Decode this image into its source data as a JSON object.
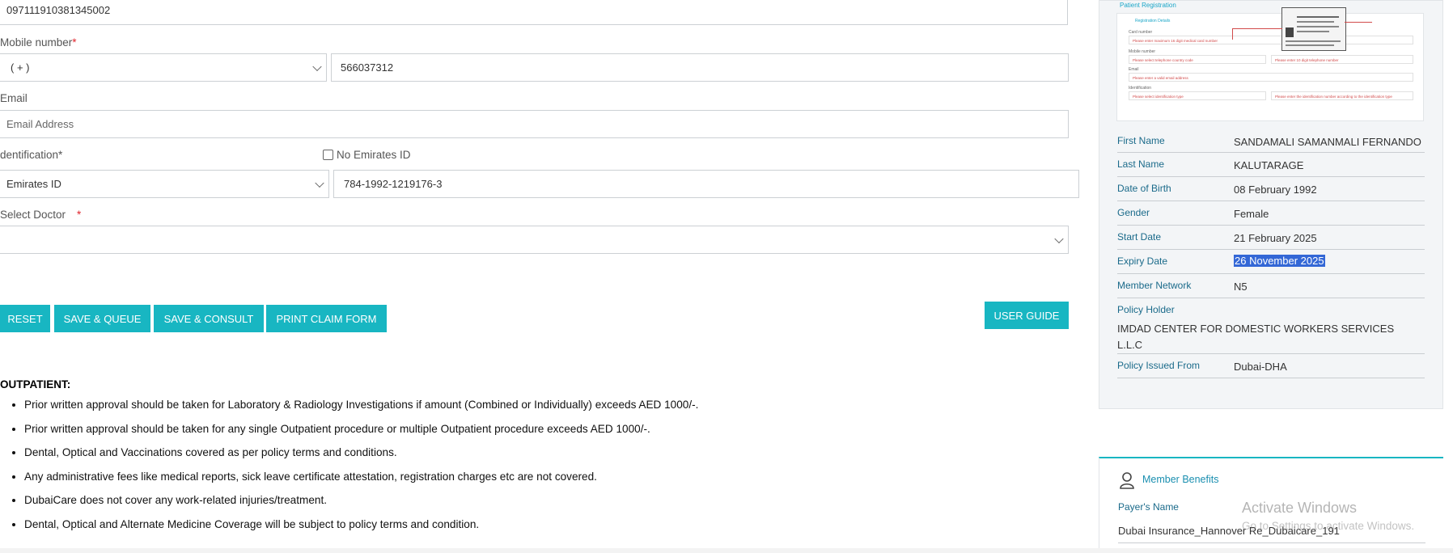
{
  "form": {
    "card_number_value": "097111910381345002",
    "mobile_label": "Mobile number",
    "mobile_country_value": "( + )",
    "mobile_number_value": "566037312",
    "email_label": "Email",
    "email_placeholder": "Email Address",
    "identification_label": "dentification*",
    "no_emirates_label": "No Emirates ID",
    "id_type_value": "Emirates ID",
    "id_number_value": "784-1992-1219176-3",
    "doctor_label": "Select Doctor",
    "doctor_value": ""
  },
  "buttons": {
    "reset": "RESET",
    "save_queue": "SAVE & QUEUE",
    "save_consult": "SAVE & CONSULT",
    "print_claim": "PRINT CLAIM FORM",
    "user_guide": "USER GUIDE"
  },
  "outpatient": {
    "title": "OUTPATIENT:",
    "items": [
      "Prior written approval should be taken for Laboratory & Radiology Investigations if amount (Combined or Individually) exceeds AED 1000/-.",
      "Prior written approval should be taken for any single Outpatient procedure or multiple Outpatient procedure exceeds AED 1000/-.",
      "Dental, Optical and Vaccinations covered as per policy terms and conditions.",
      "Any administrative fees like medical reports, sick leave certificate attestation, registration charges etc are not covered.",
      "DubaiCare does not cover any work-related injuries/treatment.",
      "Dental, Optical and Alternate Medicine Coverage will be subject to policy terms and condition."
    ]
  },
  "thumb": {
    "header": "Patient Registration",
    "sub": "Registration Details",
    "card_number": "Card number",
    "card_hint": "Please enter maximum 16 digit medical card number",
    "mobile": "Mobile number",
    "mobile_hint": "Please select telephone country code",
    "mobile_hint2": "Please enter 10 digit telephone number",
    "email": "Email",
    "email_hint": "Please enter a valid email address",
    "identification": "Identification",
    "id_hint": "Please select identification type",
    "id_hint2": "Please enter the identification number according to the identification type"
  },
  "member": {
    "rows": [
      {
        "key": "First Name",
        "value": "SANDAMALI SAMANMALI FERNANDO"
      },
      {
        "key": "Last Name",
        "value": "KALUTARAGE"
      },
      {
        "key": "Date of Birth",
        "value": "08 February 1992"
      },
      {
        "key": "Gender",
        "value": "Female"
      },
      {
        "key": "Start Date",
        "value": "21 February 2025"
      },
      {
        "key": "Expiry Date",
        "value": "26 November 2025"
      },
      {
        "key": "Member Network",
        "value": "N5"
      }
    ],
    "policy_holder_label": "Policy Holder",
    "policy_holder_value": "IMDAD CENTER FOR DOMESTIC WORKERS SERVICES L.L.C",
    "policy_issued_label": "Policy Issued From",
    "policy_issued_value": "Dubai-DHA"
  },
  "benefits": {
    "title": "Member Benefits",
    "payer_label": "Payer's Name",
    "payer_value": "Dubai Insurance_Hannover Re_Dubaicare_191"
  },
  "watermark": {
    "line1": "Activate Windows",
    "line2": "Go to Settings to activate Windows."
  },
  "colors": {
    "accent": "#18b6c2",
    "required": "#e0262d",
    "key_text": "#1a6a8a",
    "highlight": "#3367d6"
  }
}
